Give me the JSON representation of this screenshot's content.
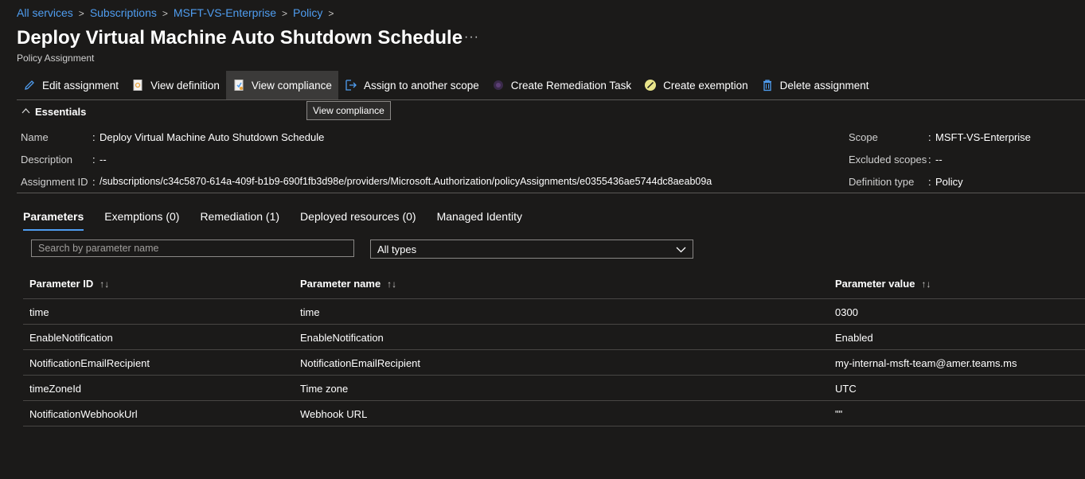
{
  "breadcrumb": [
    "All services",
    "Subscriptions",
    "MSFT-VS-Enterprise",
    "Policy"
  ],
  "title": "Deploy Virtual Machine Auto Shutdown Schedule",
  "more_label": "···",
  "subtitle": "Policy Assignment",
  "toolbar": {
    "edit": "Edit assignment",
    "view_definition": "View definition",
    "view_compliance": "View compliance",
    "assign_scope": "Assign to another scope",
    "remediation": "Create Remediation Task",
    "exemption": "Create exemption",
    "delete": "Delete assignment"
  },
  "tooltip": "View compliance",
  "essentials": {
    "heading": "Essentials",
    "name_label": "Name",
    "name_value": "Deploy Virtual Machine Auto Shutdown Schedule",
    "description_label": "Description",
    "description_value": "--",
    "assignment_id_label": "Assignment ID",
    "assignment_id_value": "/subscriptions/c34c5870-614a-409f-b1b9-690f1fb3d98e/providers/Microsoft.Authorization/policyAssignments/e0355436ae5744dc8aeab09a",
    "scope_label": "Scope",
    "scope_value": "MSFT-VS-Enterprise",
    "excluded_label": "Excluded scopes",
    "excluded_value": "--",
    "deftype_label": "Definition type",
    "deftype_value": "Policy"
  },
  "tabs": [
    "Parameters",
    "Exemptions (0)",
    "Remediation (1)",
    "Deployed resources (0)",
    "Managed Identity"
  ],
  "filters": {
    "search_placeholder": "Search by parameter name",
    "type_selected": "All types"
  },
  "table": {
    "headers": [
      "Parameter ID",
      "Parameter name",
      "Parameter value"
    ],
    "rows": [
      [
        "time",
        "time",
        "0300"
      ],
      [
        "EnableNotification",
        "EnableNotification",
        "Enabled"
      ],
      [
        "NotificationEmailRecipient",
        "NotificationEmailRecipient",
        "my-internal-msft-team@amer.teams.ms"
      ],
      [
        "timeZoneId",
        "Time zone",
        "UTC"
      ],
      [
        "NotificationWebhookUrl",
        "Webhook URL",
        "\"\""
      ]
    ]
  },
  "colors": {
    "accent": "#4f9df0",
    "background": "#1b1a19"
  }
}
